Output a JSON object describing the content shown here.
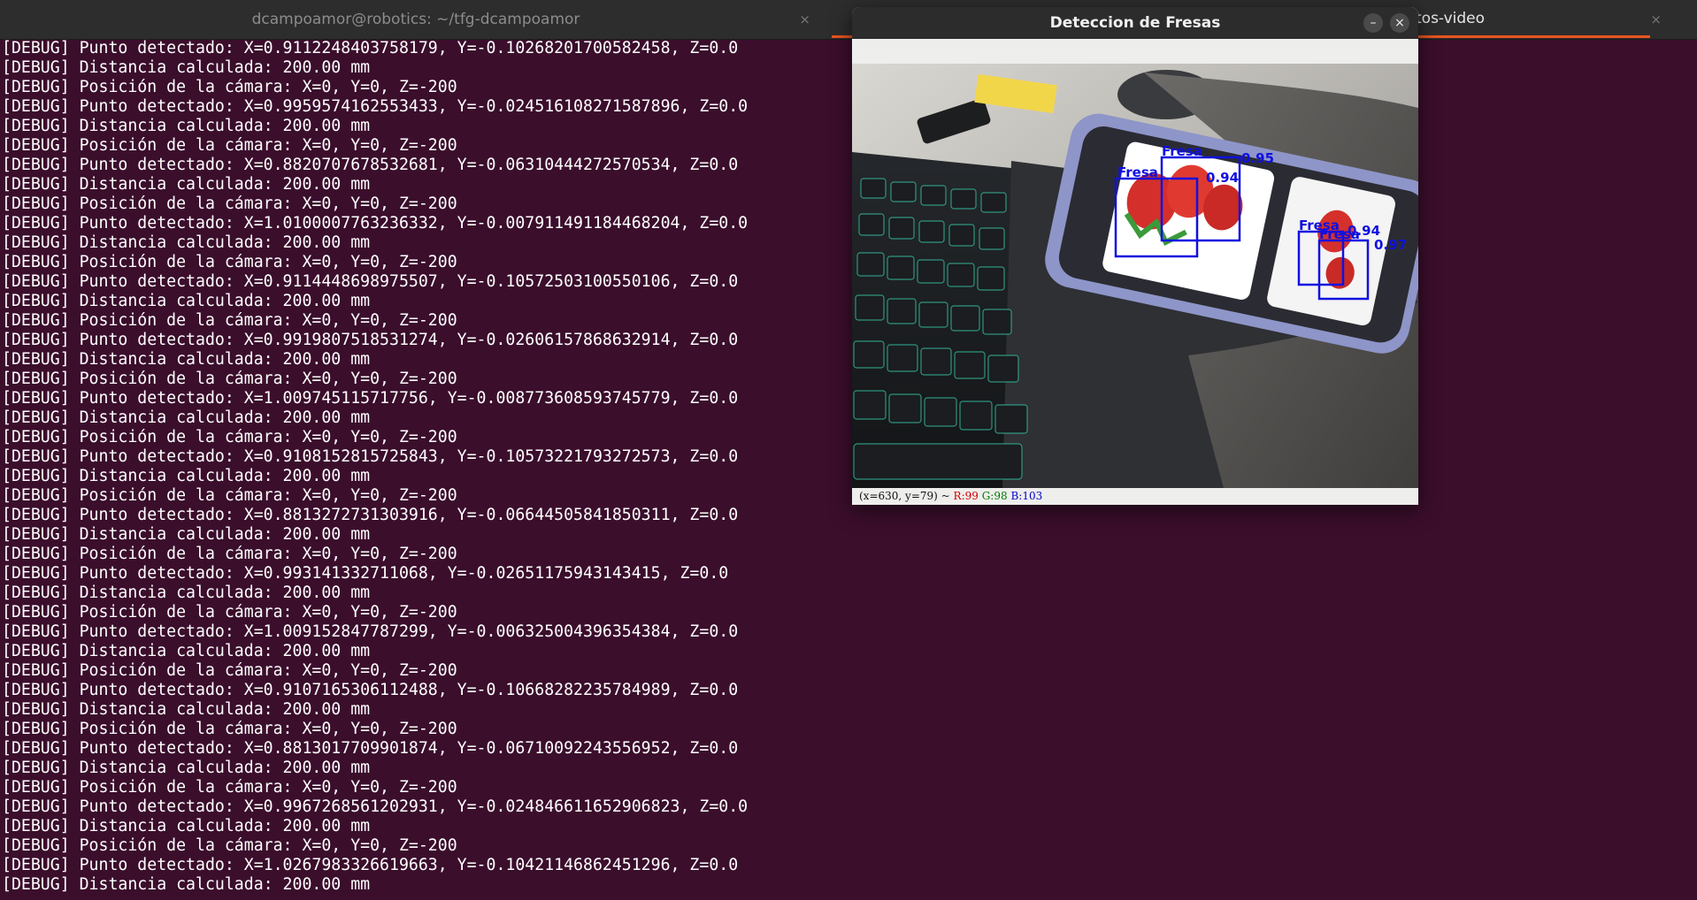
{
  "tabs": [
    {
      "title": "dcampoamor@robotics: ~/tfg-dcampoamor",
      "close": "×"
    },
    {
      "title": "tos-video",
      "close": "×"
    }
  ],
  "colors": {
    "terminal_bg": "#3b0e2c",
    "tab_accent": "#e95420",
    "box_color": "#1010e0"
  },
  "terminal": {
    "lines": [
      "[DEBUG] Punto detectado: X=0.9112248403758179, Y=-0.10268201700582458, Z=0.0",
      "[DEBUG] Distancia calculada: 200.00 mm",
      "[DEBUG] Posición de la cámara: X=0, Y=0, Z=-200",
      "[DEBUG] Punto detectado: X=0.9959574162553433, Y=-0.024516108271587896, Z=0.0",
      "[DEBUG] Distancia calculada: 200.00 mm",
      "[DEBUG] Posición de la cámara: X=0, Y=0, Z=-200",
      "[DEBUG] Punto detectado: X=0.8820707678532681, Y=-0.06310444272570534, Z=0.0",
      "[DEBUG] Distancia calculada: 200.00 mm",
      "[DEBUG] Posición de la cámara: X=0, Y=0, Z=-200",
      "[DEBUG] Punto detectado: X=1.0100007763236332, Y=-0.007911491184468204, Z=0.0",
      "[DEBUG] Distancia calculada: 200.00 mm",
      "[DEBUG] Posición de la cámara: X=0, Y=0, Z=-200",
      "[DEBUG] Punto detectado: X=0.9114448698975507, Y=-0.10572503100550106, Z=0.0",
      "[DEBUG] Distancia calculada: 200.00 mm",
      "[DEBUG] Posición de la cámara: X=0, Y=0, Z=-200",
      "[DEBUG] Punto detectado: X=0.9919807518531274, Y=-0.02606157868632914, Z=0.0",
      "[DEBUG] Distancia calculada: 200.00 mm",
      "[DEBUG] Posición de la cámara: X=0, Y=0, Z=-200",
      "[DEBUG] Punto detectado: X=1.009745115717756, Y=-0.008773608593745779, Z=0.0",
      "[DEBUG] Distancia calculada: 200.00 mm",
      "[DEBUG] Posición de la cámara: X=0, Y=0, Z=-200",
      "[DEBUG] Punto detectado: X=0.9108152815725843, Y=-0.10573221793272573, Z=0.0",
      "[DEBUG] Distancia calculada: 200.00 mm",
      "[DEBUG] Posición de la cámara: X=0, Y=0, Z=-200",
      "[DEBUG] Punto detectado: X=0.8813272731303916, Y=-0.06644505841850311, Z=0.0",
      "[DEBUG] Distancia calculada: 200.00 mm",
      "[DEBUG] Posición de la cámara: X=0, Y=0, Z=-200",
      "[DEBUG] Punto detectado: X=0.993141332711068, Y=-0.02651175943143415, Z=0.0",
      "[DEBUG] Distancia calculada: 200.00 mm",
      "[DEBUG] Posición de la cámara: X=0, Y=0, Z=-200",
      "[DEBUG] Punto detectado: X=1.009152847787299, Y=-0.006325004396354384, Z=0.0",
      "[DEBUG] Distancia calculada: 200.00 mm",
      "[DEBUG] Posición de la cámara: X=0, Y=0, Z=-200",
      "[DEBUG] Punto detectado: X=0.9107165306112488, Y=-0.10668282235784989, Z=0.0",
      "[DEBUG] Distancia calculada: 200.00 mm",
      "[DEBUG] Posición de la cámara: X=0, Y=0, Z=-200",
      "[DEBUG] Punto detectado: X=0.8813017709901874, Y=-0.06710092243556952, Z=0.0",
      "[DEBUG] Distancia calculada: 200.00 mm",
      "[DEBUG] Posición de la cámara: X=0, Y=0, Z=-200",
      "[DEBUG] Punto detectado: X=0.9967268561202931, Y=-0.024846611652906823, Z=0.0",
      "[DEBUG] Distancia calculada: 200.00 mm",
      "[DEBUG] Posición de la cámara: X=0, Y=0, Z=-200",
      "[DEBUG] Punto detectado: X=1.0267983326619663, Y=-0.10421146862451296, Z=0.0",
      "[DEBUG] Distancia calculada: 200.00 mm"
    ]
  },
  "window": {
    "title": "Deteccion de Fresas",
    "minimize": "–",
    "close": "×",
    "detections": [
      {
        "label": "Fresa",
        "score": ""
      },
      {
        "label": "Fresa",
        "score": "0.94"
      },
      {
        "label": "",
        "score": "0.95"
      },
      {
        "label": "Fresa",
        "score": ""
      },
      {
        "label": "Fresa",
        "score": "0.94"
      },
      {
        "label": "",
        "score": "0.97"
      }
    ],
    "status": {
      "coords": "(x=630, y=79) ~",
      "r": "R:99",
      "g": "G:98",
      "b": "B:103"
    }
  }
}
